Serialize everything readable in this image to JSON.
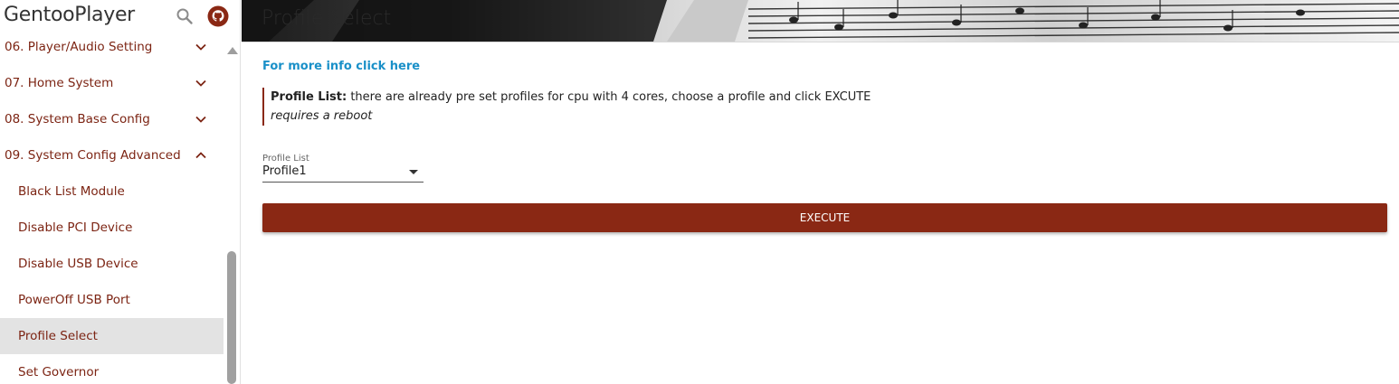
{
  "app": {
    "brand": "GentooPlayer"
  },
  "icons": {
    "search": "search-icon",
    "github": "github-icon"
  },
  "colors": {
    "accent": "#8a2814",
    "link": "#1a90c8",
    "nav_text": "#7c2413",
    "active_bg": "#e3e3e3"
  },
  "sidebar": {
    "items": [
      {
        "label": "06. Player/Audio Setting",
        "expanded": false
      },
      {
        "label": "07. Home System",
        "expanded": false
      },
      {
        "label": "08. System Base Config",
        "expanded": false
      },
      {
        "label": "09. System Config Advanced",
        "expanded": true
      },
      {
        "label": "Black List Module"
      },
      {
        "label": "Disable PCI Device"
      },
      {
        "label": "Disable USB Device"
      },
      {
        "label": "PowerOff USB Port"
      },
      {
        "label": "Profile Select",
        "active": true
      },
      {
        "label": "Set Governor"
      }
    ]
  },
  "header": {
    "title": "Profile Select"
  },
  "main": {
    "info_link": "For more info click here",
    "note": {
      "bold": "Profile List:",
      "text": " there are already pre set profiles for cpu with 4 cores, choose a profile and click EXCUTE",
      "italic": "requires a reboot"
    },
    "profile_field": {
      "label": "Profile List",
      "value": "Profile1"
    },
    "execute_label": "EXECUTE"
  }
}
